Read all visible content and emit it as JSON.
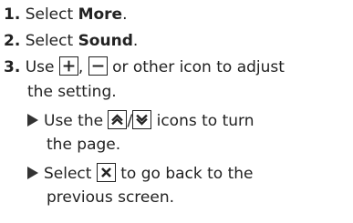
{
  "steps": [
    {
      "number": "1.",
      "before": "Select ",
      "bold": "More",
      "after": "."
    },
    {
      "number": "2.",
      "before": "Select ",
      "bold": "Sound",
      "after": "."
    },
    {
      "number": "3.",
      "part1": "Use",
      "sep1": ",",
      "part2": "or other icon to adjust",
      "line2": "the setting."
    }
  ],
  "notes": [
    {
      "part1": "Use the",
      "sep": "/",
      "part2": "icons to turn",
      "line2": "the page."
    },
    {
      "part1": "Select",
      "part2": "to go back to the",
      "line2": "previous screen."
    }
  ],
  "icons": [
    "plus-icon",
    "minus-icon",
    "page-up-icon",
    "page-down-icon",
    "close-icon"
  ]
}
